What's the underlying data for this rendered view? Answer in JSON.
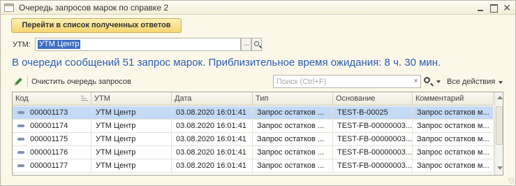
{
  "window": {
    "title": "Очередь запросов марок по справке 2"
  },
  "actions": {
    "goto_responses": "Перейти в список полученных ответов"
  },
  "utm": {
    "label": "УТМ:",
    "value": "УТМ Центр",
    "select_button": "..."
  },
  "info_message": "В очереди сообщений 51 запрос марок. Приблизительное время ожидания: 8 ч. 30 мин.",
  "toolbar": {
    "clear_queue": "Очистить очередь запросов",
    "search_placeholder": "Поиск (Ctrl+F)",
    "search_clear": "×",
    "all_actions": "Все действия"
  },
  "table": {
    "columns": [
      "Код",
      "УТМ",
      "Дата",
      "Тип",
      "Основание",
      "Комментарий"
    ],
    "rows": [
      {
        "code": "000001173",
        "utm": "УТМ Центр",
        "date": "03.08.2020 16:01:41",
        "type": "Запрос остатков ...",
        "basis": "TEST-B-00025",
        "comment": "Запрос остатков м...",
        "selected": true
      },
      {
        "code": "000001174",
        "utm": "УТМ Центр",
        "date": "03.08.2020 16:01:41",
        "type": "Запрос остатков ...",
        "basis": "TEST-FB-00000003...",
        "comment": "Запрос остатков м..."
      },
      {
        "code": "000001175",
        "utm": "УТМ Центр",
        "date": "03.08.2020 16:01:41",
        "type": "Запрос остатков ...",
        "basis": "TEST-FB-00000003...",
        "comment": "Запрос остатков м..."
      },
      {
        "code": "000001176",
        "utm": "УТМ Центр",
        "date": "03.08.2020 16:01:41",
        "type": "Запрос остатков ...",
        "basis": "TEST-FB-00000003...",
        "comment": "Запрос остатков м..."
      },
      {
        "code": "000001177",
        "utm": "УТМ Центр",
        "date": "03.08.2020 16:01:41",
        "type": "Запрос остатков ...",
        "basis": "TEST-FB-00000003...",
        "comment": "Запрос остатков м..."
      }
    ]
  },
  "colors": {
    "accent_text": "#2a5db3",
    "selection": "#c3daf7",
    "button_yellow": "#f5d56f"
  }
}
